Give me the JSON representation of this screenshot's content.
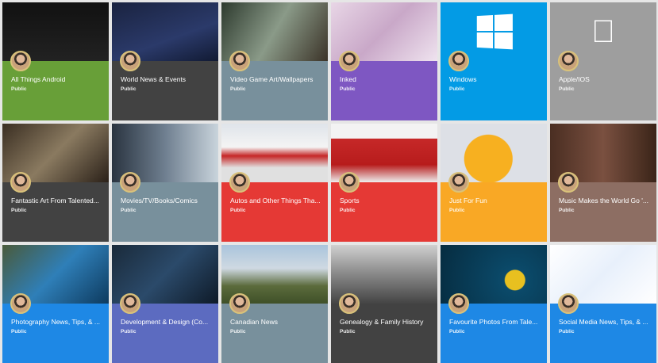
{
  "collections": [
    {
      "title": "All Things Android",
      "visibility": "Public",
      "color": "#689f38",
      "image": "linear-gradient(#111,#222)",
      "icon": "android-evolution"
    },
    {
      "title": "World News & Events",
      "visibility": "Public",
      "color": "#424242",
      "image": "linear-gradient(160deg,#1a2340,#2b3a6a 60%,#111a33)",
      "icon": "world-map"
    },
    {
      "title": "Video Game Art/Wallpapers",
      "visibility": "Public",
      "color": "#78909c",
      "image": "linear-gradient(120deg,#2d3a2e,#8a9a88 50%,#3b3328)",
      "icon": ""
    },
    {
      "title": "Inked",
      "visibility": "Public",
      "color": "#7e57c2",
      "image": "linear-gradient(135deg,#e8d6e6,#c9a8c8 50%,#efe3ef)",
      "icon": ""
    },
    {
      "title": "Windows",
      "visibility": "Public",
      "color": "#039be5",
      "image": "#039be5",
      "icon": "windows-logo"
    },
    {
      "title": "Apple/IOS",
      "visibility": "Public",
      "color": "#9e9e9e",
      "image": "#9e9e9e",
      "icon": "apple-logo"
    },
    {
      "title": "Fantastic Art From Talented...",
      "visibility": "Public",
      "color": "#424242",
      "image": "linear-gradient(135deg,#3a2e22,#8a7a60 50%,#2a2018)",
      "icon": ""
    },
    {
      "title": "Movies/TV/Books/Comics",
      "visibility": "Public",
      "color": "#78909c",
      "image": "linear-gradient(90deg,#2a3440,#6f7f90 50%,#c9d4dc)",
      "icon": ""
    },
    {
      "title": "Autos and Other Things Tha...",
      "visibility": "Public",
      "color": "#e53935",
      "image": "linear-gradient(#dfe4ea,#f4f4f4 40%,#c62828 55%,#e0e0e0 75%)",
      "icon": ""
    },
    {
      "title": "Sports",
      "visibility": "Public",
      "color": "#e53935",
      "image": "linear-gradient(#f3f3f3 25%,#c62828 26%,#b71c1c 70%,#eee)",
      "icon": ""
    },
    {
      "title": "Just For Fun",
      "visibility": "Public",
      "color": "#f9a825",
      "image": "radial-gradient(circle at 45% 60%,#f7b020 0 35%,#dde0e6 36%)",
      "icon": ""
    },
    {
      "title": "Music Makes the World Go '...",
      "visibility": "Public",
      "color": "#8d6e63",
      "image": "linear-gradient(90deg,#4a2e22,#7a5040 50%,#3a2418)",
      "icon": ""
    },
    {
      "title": "Photography News, Tips, & ...",
      "visibility": "Public",
      "color": "#1e88e5",
      "image": "linear-gradient(135deg,#4a5a3a,#2f7fb8 50%,#0d3a5e)",
      "icon": ""
    },
    {
      "title": "Development & Design (Co...",
      "visibility": "Public",
      "color": "#5c6bc0",
      "image": "linear-gradient(135deg,#1a2a3a,#2b4a6a 50%,#0e1a28)",
      "icon": ""
    },
    {
      "title": "Canadian News",
      "visibility": "Public",
      "color": "#78909c",
      "image": "linear-gradient(#a9c4dc,#cfd9e2 40%,#5b6b3c 70%,#3f5028)",
      "icon": ""
    },
    {
      "title": "Genealogy & Family History",
      "visibility": "Public",
      "color": "#424242",
      "image": "linear-gradient(#d0d0d0,#888 50%,#444)",
      "icon": ""
    },
    {
      "title": "Favourite Photos From Tale...",
      "visibility": "Public",
      "color": "#1e88e5",
      "image": "radial-gradient(circle at 70% 60%,#e8c020 0 12%,#0b4a6a 13%,#062c40)",
      "icon": ""
    },
    {
      "title": "Social Media News, Tips, & ...",
      "visibility": "Public",
      "color": "#1e88e5",
      "image": "linear-gradient(135deg,#fff,#e8f0fb 50%,#fff)",
      "icon": "social-logos"
    }
  ]
}
